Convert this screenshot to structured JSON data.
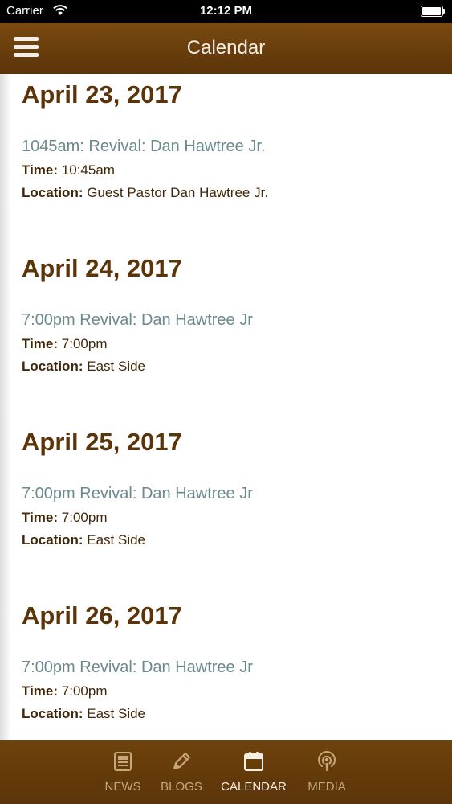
{
  "status_bar": {
    "carrier": "Carrier",
    "time": "12:12 PM"
  },
  "header": {
    "title": "Calendar"
  },
  "days": [
    {
      "date": "April 23, 2017",
      "event_title": "1045am: Revival: Dan Hawtree Jr.",
      "time_label": "Time:",
      "time_value": "10:45am",
      "location_label": "Location:",
      "location_value": "Guest Pastor Dan Hawtree Jr."
    },
    {
      "date": "April 24, 2017",
      "event_title": "7:00pm Revival: Dan Hawtree Jr",
      "time_label": "Time:",
      "time_value": "7:00pm",
      "location_label": "Location:",
      "location_value": "East Side"
    },
    {
      "date": "April 25, 2017",
      "event_title": "7:00pm Revival: Dan Hawtree Jr",
      "time_label": "Time:",
      "time_value": "7:00pm",
      "location_label": "Location:",
      "location_value": "East Side"
    },
    {
      "date": "April 26, 2017",
      "event_title": "7:00pm Revival: Dan Hawtree Jr",
      "time_label": "Time:",
      "time_value": "7:00pm",
      "location_label": "Location:",
      "location_value": "East Side"
    }
  ],
  "tabs": [
    {
      "label": "NEWS",
      "icon": "newspaper-icon",
      "active": false
    },
    {
      "label": "BLOGS",
      "icon": "pencil-icon",
      "active": false
    },
    {
      "label": "CALENDAR",
      "icon": "calendar-icon",
      "active": true
    },
    {
      "label": "MEDIA",
      "icon": "podcast-icon",
      "active": false
    }
  ],
  "colors": {
    "brand_brown": "#5b3409",
    "event_link": "#6b8a8e",
    "tab_inactive": "#c7a77c",
    "tab_active": "#f5efe6"
  }
}
